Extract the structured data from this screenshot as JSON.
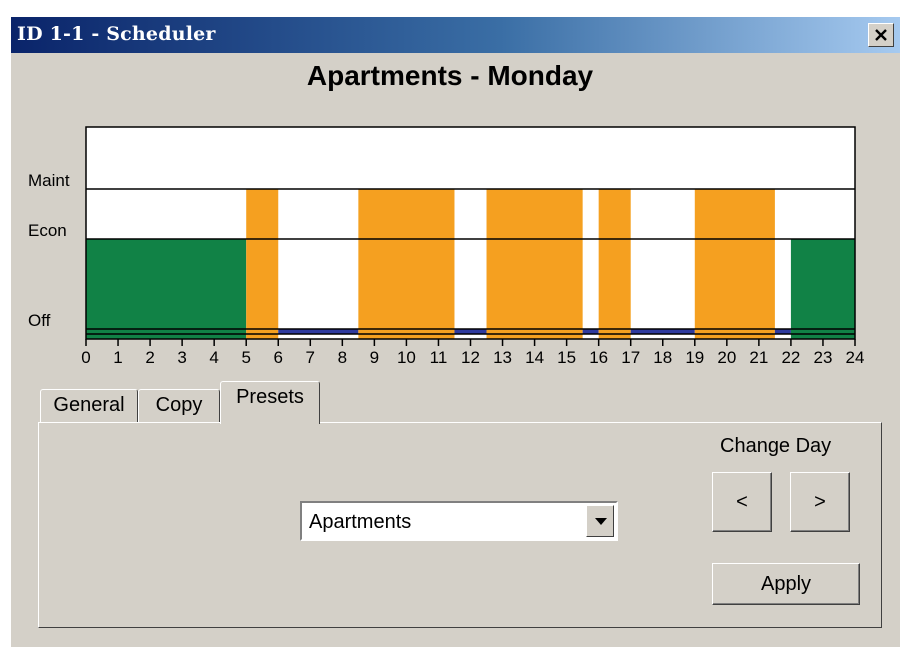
{
  "window": {
    "title": "ID 1-1 - Scheduler"
  },
  "chart_data": {
    "type": "timeline",
    "title": "Apartments - Monday",
    "x_ticks": [
      0,
      1,
      2,
      3,
      4,
      5,
      6,
      7,
      8,
      9,
      10,
      11,
      12,
      13,
      14,
      15,
      16,
      17,
      18,
      19,
      20,
      21,
      22,
      23,
      24
    ],
    "xlim": [
      0,
      24
    ],
    "y_levels": [
      "Off",
      "Econ",
      "Maint"
    ],
    "segments": [
      {
        "start": 0,
        "end": 5,
        "mode": "Econ",
        "color": "#118246"
      },
      {
        "start": 5,
        "end": 6,
        "mode": "Maint",
        "color": "#f5a020"
      },
      {
        "start": 6,
        "end": 8.5,
        "mode": "Off",
        "color": "#2e3a9e"
      },
      {
        "start": 8.5,
        "end": 11.5,
        "mode": "Maint",
        "color": "#f5a020"
      },
      {
        "start": 11.5,
        "end": 12.5,
        "mode": "Off",
        "color": "#2e3a9e"
      },
      {
        "start": 12.5,
        "end": 15.5,
        "mode": "Maint",
        "color": "#f5a020"
      },
      {
        "start": 15.5,
        "end": 16,
        "mode": "Off",
        "color": "#2e3a9e"
      },
      {
        "start": 16,
        "end": 17,
        "mode": "Maint",
        "color": "#f5a020"
      },
      {
        "start": 17,
        "end": 19,
        "mode": "Off",
        "color": "#2e3a9e"
      },
      {
        "start": 19,
        "end": 21.5,
        "mode": "Maint",
        "color": "#f5a020"
      },
      {
        "start": 21.5,
        "end": 22,
        "mode": "Off",
        "color": "#2e3a9e"
      },
      {
        "start": 22,
        "end": 24,
        "mode": "Econ",
        "color": "#118246"
      }
    ]
  },
  "tabs": [
    {
      "label": "General"
    },
    {
      "label": "Copy"
    },
    {
      "label": "Presets"
    }
  ],
  "presets": {
    "selected": "Apartments",
    "change_day_label": "Change Day",
    "prev_label": "<",
    "next_label": ">",
    "apply_label": "Apply"
  }
}
